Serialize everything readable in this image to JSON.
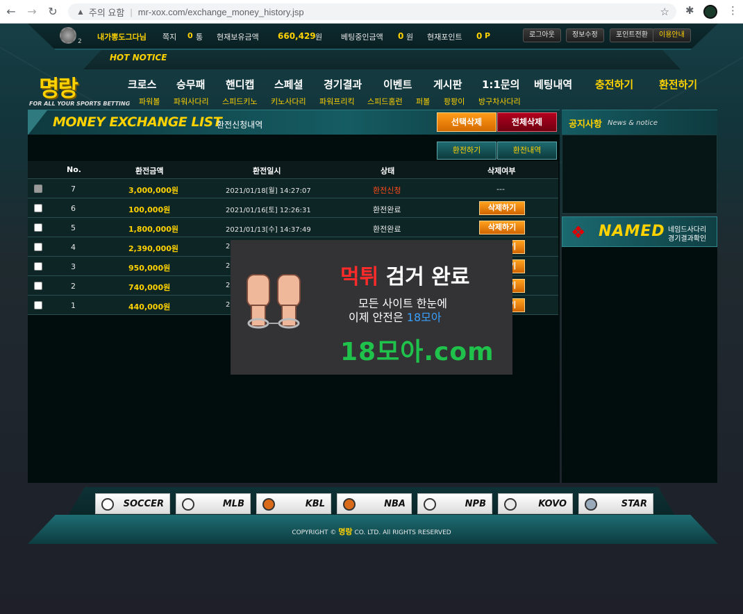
{
  "browser": {
    "security_label": "주의 요함",
    "url": "mr-xox.com/exchange_money_history.jsp"
  },
  "userbar": {
    "level": "2",
    "username": "내가뽕도그다님",
    "memo_label": "쪽지",
    "memo_count": "0",
    "memo_unit": "통",
    "balance_label": "현재보유금액",
    "balance_value": "660,429",
    "balance_unit": "원",
    "betting_label": "베팅중인금액",
    "betting_value": "0",
    "betting_unit": "원",
    "points_label": "현재포인트",
    "points_value": "0",
    "points_unit": "P",
    "buttons": [
      "로그아웃",
      "정보수정",
      "포인트전환",
      "이용안내"
    ]
  },
  "hot_notice": "HOT NOTICE",
  "logo": {
    "name": "명랑",
    "tagline": "FOR ALL YOUR SPORTS BETTING"
  },
  "menu": [
    "크로스",
    "승무패",
    "핸디캡",
    "스페셜",
    "경기결과",
    "이벤트",
    "게시판",
    "1:1문의",
    "베팅내역",
    "충전하기",
    "환전하기"
  ],
  "submenu": [
    "파워볼",
    "파워사다리",
    "스피드키노",
    "키노사다리",
    "파워프리킥",
    "스피드홈런",
    "퍼볼",
    "팡팡이",
    "방구차사다리"
  ],
  "panel": {
    "title": "MONEY EXCHANGE LIST",
    "subtitle": "환전신청내역",
    "select_delete": "선택삭제",
    "delete_all": "전체삭제",
    "tab_exchange": "환전하기",
    "tab_history": "환전내역"
  },
  "table": {
    "headers": [
      "No.",
      "환전금액",
      "환전일시",
      "상태",
      "삭제여부"
    ],
    "delete_label": "삭제하기",
    "rows": [
      {
        "no": "7",
        "amount": "3,000,000원",
        "date": "2021/01/18[월] 14:27:07",
        "status": "환전신청",
        "del": "---"
      },
      {
        "no": "6",
        "amount": "100,000원",
        "date": "2021/01/16[토] 12:26:31",
        "status": "환전완료",
        "del": "btn"
      },
      {
        "no": "5",
        "amount": "1,800,000원",
        "date": "2021/01/13[수] 14:37:49",
        "status": "환전완료",
        "del": "btn"
      },
      {
        "no": "4",
        "amount": "2,390,000원",
        "date": "2",
        "status": "",
        "del": "btn"
      },
      {
        "no": "3",
        "amount": "950,000원",
        "date": "2",
        "status": "",
        "del": "btn"
      },
      {
        "no": "2",
        "amount": "740,000원",
        "date": "2",
        "status": "",
        "del": "btn"
      },
      {
        "no": "1",
        "amount": "440,000원",
        "date": "2",
        "status": "",
        "del": "btn"
      }
    ]
  },
  "notice": {
    "title": "공지사항",
    "subtitle": "News & notice"
  },
  "named": {
    "brand": "NAMED",
    "line1": "네임드사다리",
    "line2": "경기결과확인"
  },
  "ad": {
    "headline_red": "먹튀",
    "headline_rest": " 검거 완료",
    "line1": "모든 사이트 한눈에",
    "line2_prefix": "이제 안전은 ",
    "line2_blue": "18모아",
    "domain": "18모아.com"
  },
  "sports": [
    "SOCCER",
    "MLB",
    "KBL",
    "NBA",
    "NPB",
    "KOVO",
    "STAR"
  ],
  "footer": {
    "prefix": "COPYRIGHT ©",
    "brand": "명랑",
    "suffix": "CO. LTD.  All RIGHTS RESERVED"
  }
}
